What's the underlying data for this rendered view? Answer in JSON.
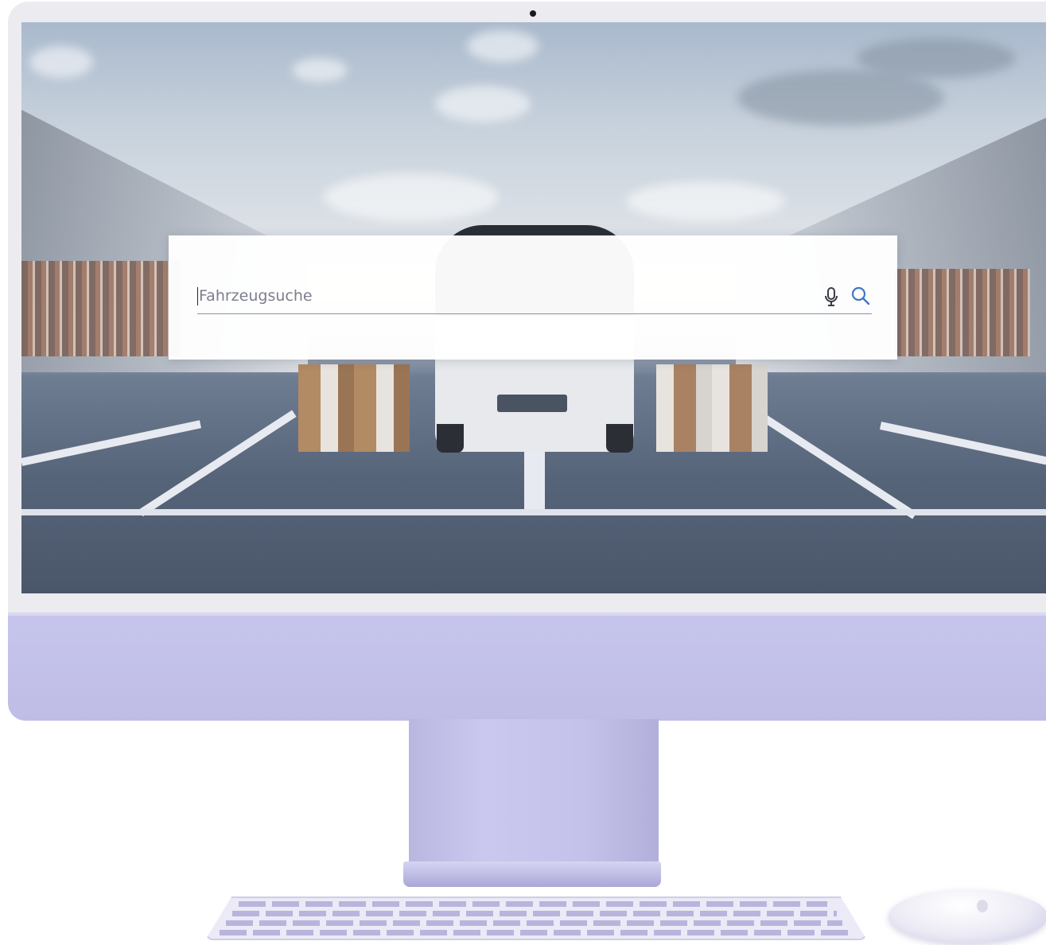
{
  "search": {
    "placeholder": "Fahrzeugsuche",
    "value": ""
  },
  "icons": {
    "mic": "microphone-icon",
    "search": "magnifier-icon"
  },
  "colors": {
    "search_icon": "#3f78c2",
    "mic_icon": "#3a3b45",
    "chassis": "#c4c2ea"
  }
}
